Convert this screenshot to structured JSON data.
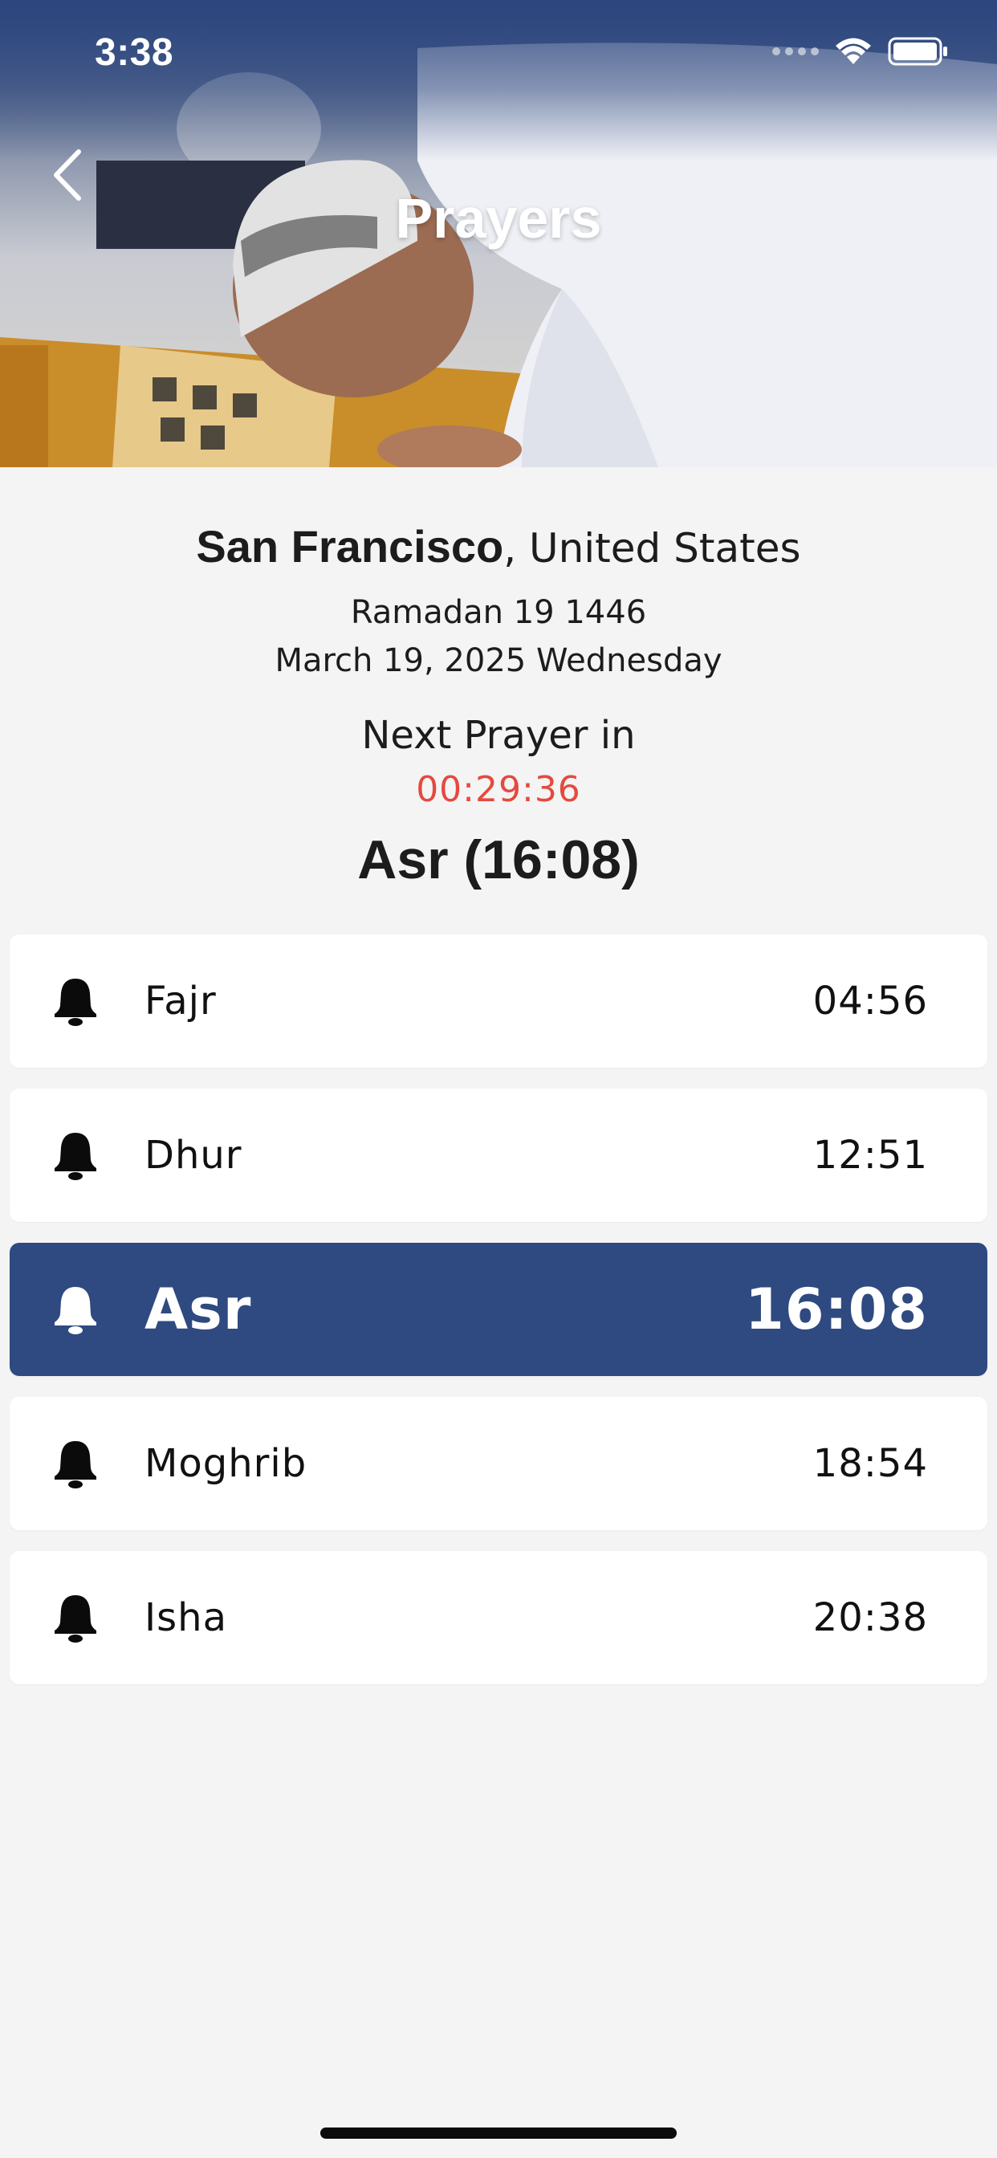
{
  "status_bar": {
    "time": "3:38"
  },
  "header": {
    "title": "Prayers"
  },
  "location": {
    "city": "San Francisco",
    "country": ", United States"
  },
  "dates": {
    "hijri": "Ramadan 19 1446",
    "gregorian": "March 19, 2025 Wednesday"
  },
  "next_prayer": {
    "label": "Next Prayer in",
    "countdown": "00:29:36",
    "summary": "Asr (16:08)"
  },
  "prayers": [
    {
      "name": "Fajr",
      "time": "04:56",
      "active": false
    },
    {
      "name": "Dhur",
      "time": "12:51",
      "active": false
    },
    {
      "name": "Asr",
      "time": "16:08",
      "active": true
    },
    {
      "name": "Moghrib",
      "time": "18:54",
      "active": false
    },
    {
      "name": "Isha",
      "time": "20:38",
      "active": false
    }
  ],
  "colors": {
    "accent": "#2f4a80",
    "countdown": "#e44a3f",
    "background": "#f4f4f4"
  },
  "icons": {
    "back": "chevron-left-icon",
    "alarm": "bell-icon",
    "signal": "signal-icon",
    "wifi": "wifi-icon",
    "battery": "battery-icon"
  }
}
